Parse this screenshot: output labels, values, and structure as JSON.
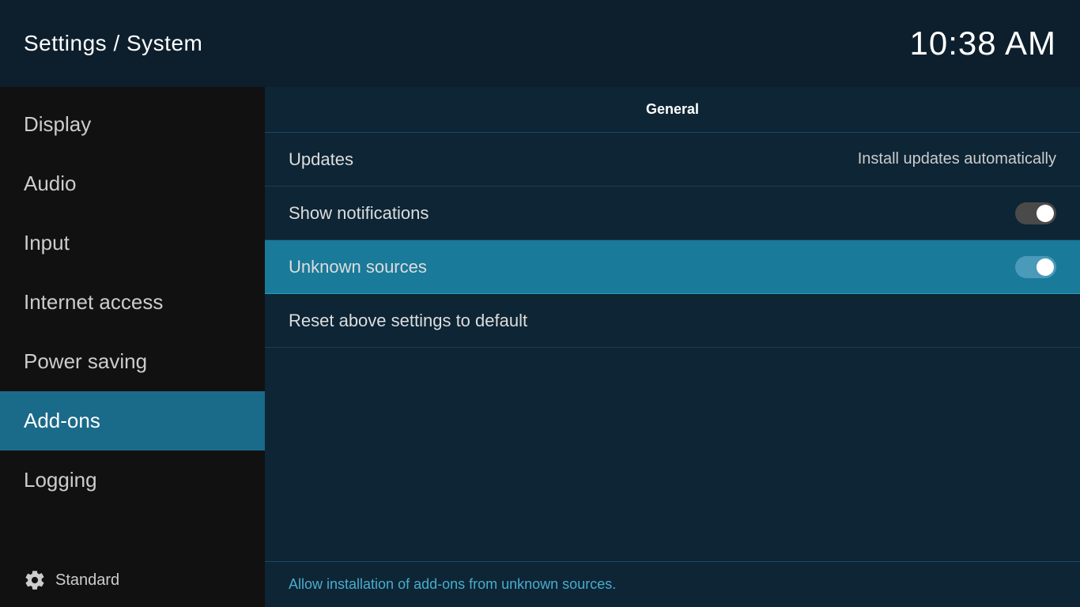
{
  "header": {
    "title": "Settings / System",
    "time": "10:38 AM"
  },
  "sidebar": {
    "items": [
      {
        "id": "display",
        "label": "Display",
        "active": false
      },
      {
        "id": "audio",
        "label": "Audio",
        "active": false
      },
      {
        "id": "input",
        "label": "Input",
        "active": false
      },
      {
        "id": "internet-access",
        "label": "Internet access",
        "active": false
      },
      {
        "id": "power-saving",
        "label": "Power saving",
        "active": false
      },
      {
        "id": "add-ons",
        "label": "Add-ons",
        "active": true
      },
      {
        "id": "logging",
        "label": "Logging",
        "active": false
      }
    ],
    "footer_label": "Standard"
  },
  "content": {
    "section_label": "General",
    "rows": [
      {
        "id": "updates",
        "label": "Updates",
        "value": "Install updates automatically",
        "toggle": null,
        "highlighted": false
      },
      {
        "id": "show-notifications",
        "label": "Show notifications",
        "value": null,
        "toggle": "off",
        "highlighted": false
      },
      {
        "id": "unknown-sources",
        "label": "Unknown sources",
        "value": null,
        "toggle": "on",
        "highlighted": true
      },
      {
        "id": "reset-settings",
        "label": "Reset above settings to default",
        "value": null,
        "toggle": null,
        "highlighted": false
      }
    ],
    "hint_text": "Allow installation of add-ons from unknown sources."
  }
}
